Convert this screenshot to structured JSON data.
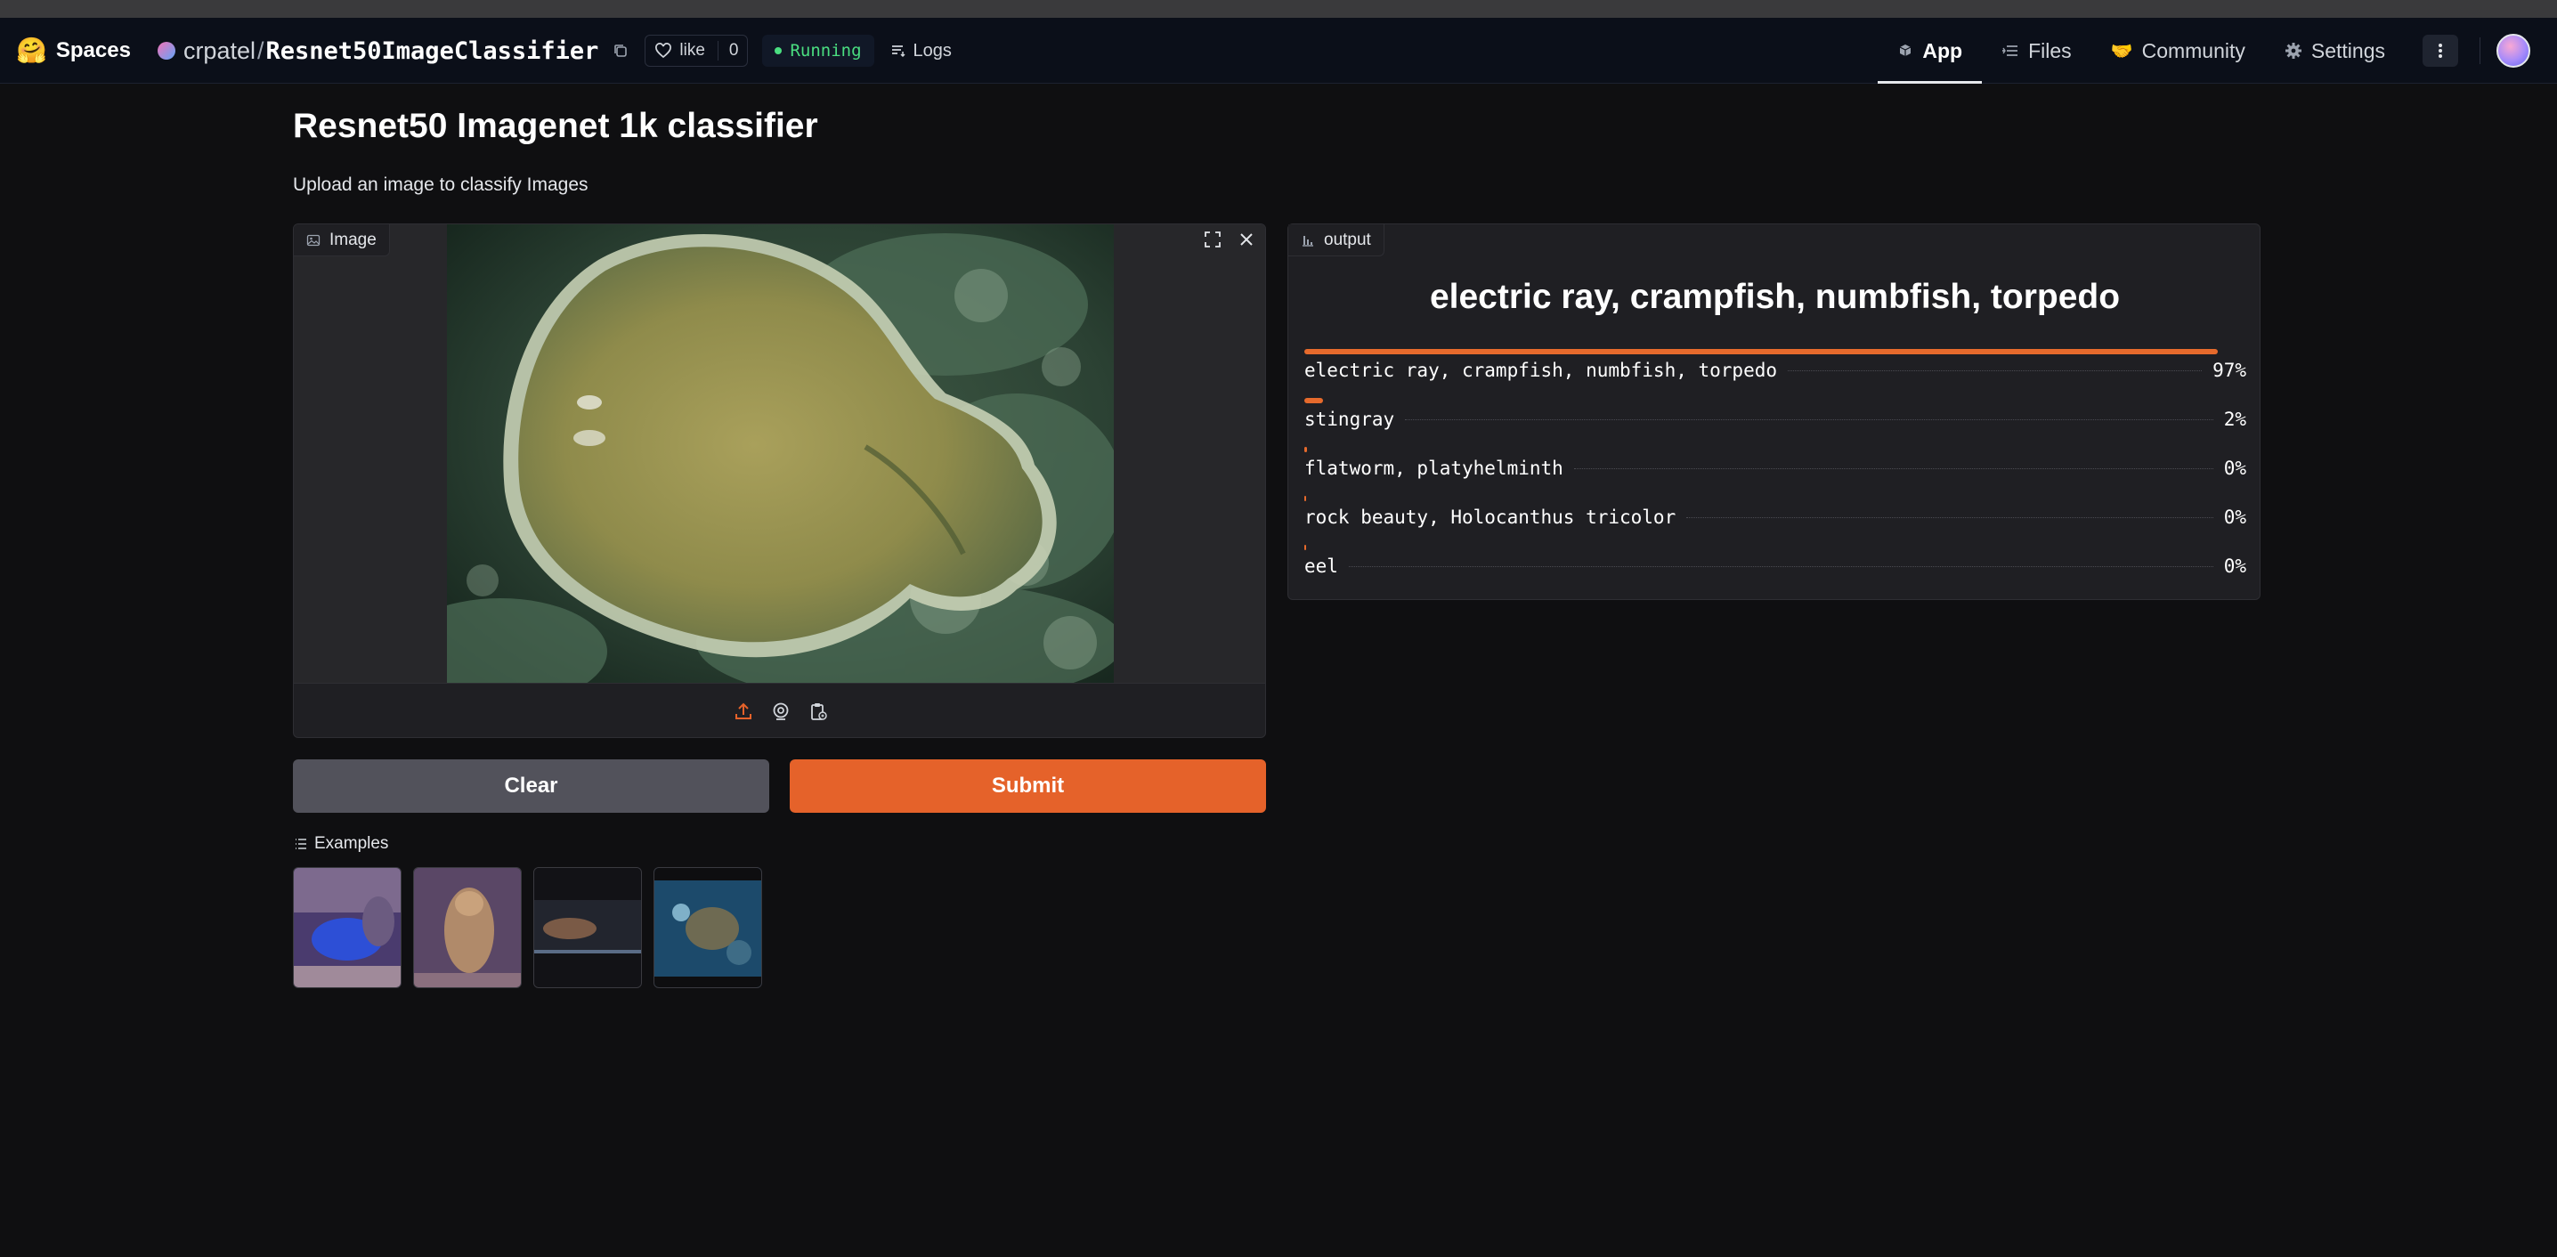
{
  "header": {
    "brand_emoji": "🤗",
    "brand_label": "Spaces",
    "owner": "crpatel",
    "separator": "/",
    "repo": "Resnet50ImageClassifier",
    "like_label": "like",
    "like_count": "0",
    "status": "Running",
    "logs_label": "Logs",
    "tabs": [
      {
        "label": "App",
        "icon": "cube-icon"
      },
      {
        "label": "Files",
        "icon": "files-icon"
      },
      {
        "label": "Community",
        "icon": "community-icon"
      },
      {
        "label": "Settings",
        "icon": "gear-icon"
      }
    ],
    "community_emoji": "🤝"
  },
  "main": {
    "title": "Resnet50 Imagenet 1k classifier",
    "description": "Upload an image to classify Images",
    "image_panel_label": "Image",
    "output_panel_label": "output",
    "top_prediction": "electric ray, crampfish, numbfish, torpedo",
    "predictions": [
      {
        "label": "electric ray, crampfish, numbfish, torpedo",
        "percent": "97%",
        "fraction": 0.97
      },
      {
        "label": "stingray",
        "percent": "2%",
        "fraction": 0.02
      },
      {
        "label": "flatworm, platyhelminth",
        "percent": "0%",
        "fraction": 0.003
      },
      {
        "label": "rock beauty, Holocanthus tricolor",
        "percent": "0%",
        "fraction": 0.001
      },
      {
        "label": "eel",
        "percent": "0%",
        "fraction": 0.001
      }
    ],
    "clear_label": "Clear",
    "submit_label": "Submit",
    "examples_label": "Examples"
  },
  "colors": {
    "accent": "#e5622a",
    "running": "#4ade80",
    "background": "#0f0f11"
  }
}
